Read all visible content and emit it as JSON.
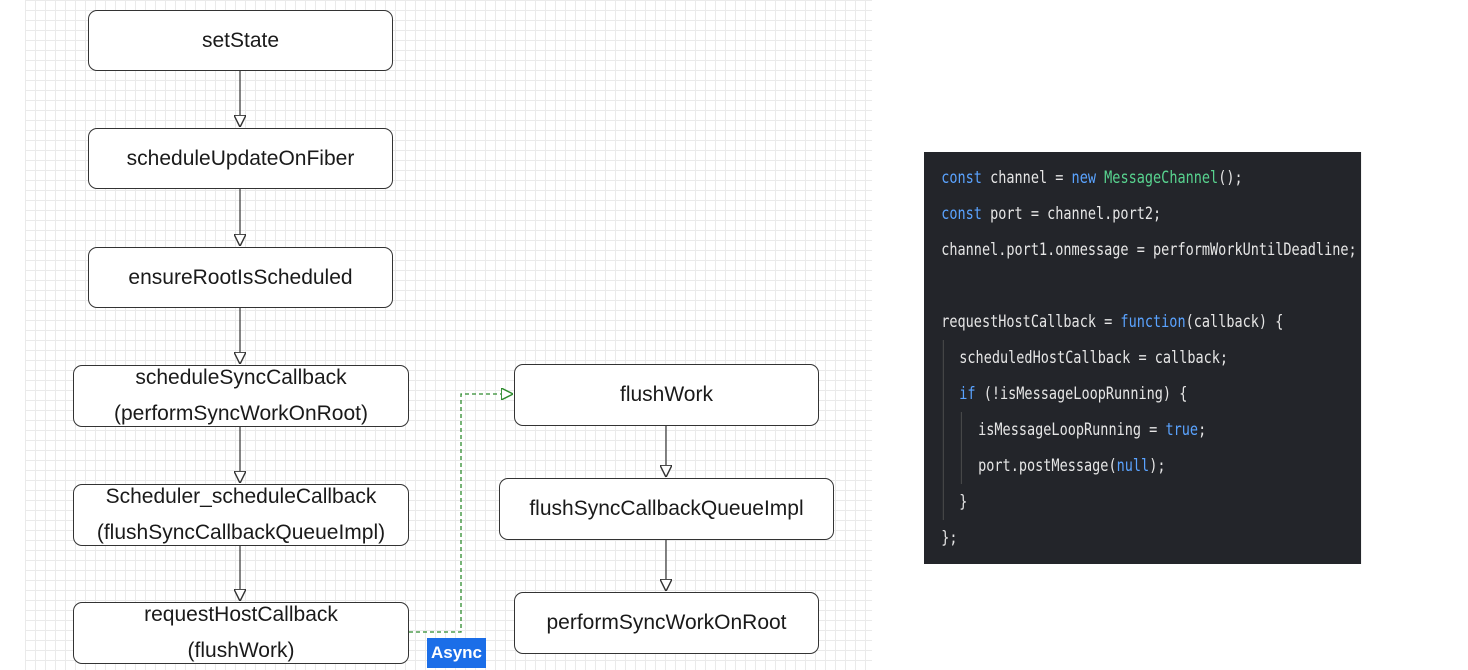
{
  "diagram": {
    "nodes": {
      "set_state": {
        "label": "setState"
      },
      "schedule_update_on_fiber": {
        "label": "scheduleUpdateOnFiber"
      },
      "ensure_root_is_scheduled": {
        "label": "ensureRootIsScheduled"
      },
      "schedule_sync_callback": {
        "line1": "scheduleSyncCallback",
        "line2": "(performSyncWorkOnRoot)"
      },
      "scheduler_schedule_callback": {
        "line1": "Scheduler_scheduleCallback",
        "line2": "(flushSyncCallbackQueueImpl)"
      },
      "request_host_callback": {
        "line1": "requestHostCallback",
        "line2": "(flushWork)"
      },
      "flush_work": {
        "label": "flushWork"
      },
      "flush_sync_callback_queue_impl": {
        "label": "flushSyncCallbackQueueImpl"
      },
      "perform_sync_work_on_root": {
        "label": "performSyncWorkOnRoot"
      }
    },
    "edges": [
      {
        "from": "set_state",
        "to": "schedule_update_on_fiber",
        "style": "solid"
      },
      {
        "from": "schedule_update_on_fiber",
        "to": "ensure_root_is_scheduled",
        "style": "solid"
      },
      {
        "from": "ensure_root_is_scheduled",
        "to": "schedule_sync_callback",
        "style": "solid"
      },
      {
        "from": "schedule_sync_callback",
        "to": "scheduler_schedule_callback",
        "style": "solid"
      },
      {
        "from": "scheduler_schedule_callback",
        "to": "request_host_callback",
        "style": "solid"
      },
      {
        "from": "request_host_callback",
        "to": "flush_work",
        "style": "dashed",
        "color": "#2e8b2e"
      },
      {
        "from": "flush_work",
        "to": "flush_sync_callback_queue_impl",
        "style": "solid"
      },
      {
        "from": "flush_sync_callback_queue_impl",
        "to": "perform_sync_work_on_root",
        "style": "solid"
      }
    ],
    "async_label": "Async",
    "colors": {
      "async_badge": "#1b6ee8",
      "async_edge": "#2e8b2e"
    }
  },
  "code": {
    "colors": {
      "background": "#23252a",
      "keyword": "#5aa3ff",
      "class_name": "#58d38f",
      "text": "#e6e6e6"
    },
    "lines": {
      "l1": {
        "kw": "const",
        "t1": " channel = ",
        "kw2": "new",
        "sp": " ",
        "cls": "MessageChannel",
        "t2": "();"
      },
      "l2": {
        "kw": "const",
        "t1": " port = channel.port2;"
      },
      "l3": {
        "t1": "channel.port1.onmessage = performWorkUntilDeadline;"
      },
      "l5": {
        "t1": "requestHostCallback = ",
        "kw": "function",
        "t2": "(callback) {"
      },
      "l6": {
        "t1": "scheduledHostCallback = callback;"
      },
      "l7": {
        "kw": "if",
        "t1": " (!isMessageLoopRunning) {"
      },
      "l8": {
        "t1": "isMessageLoopRunning = ",
        "kw": "true",
        "t2": ";"
      },
      "l9": {
        "t1": "port.postMessage(",
        "kw": "null",
        "t2": ");"
      },
      "l10": {
        "t1": "}"
      },
      "l11": {
        "t1": "};"
      }
    }
  }
}
